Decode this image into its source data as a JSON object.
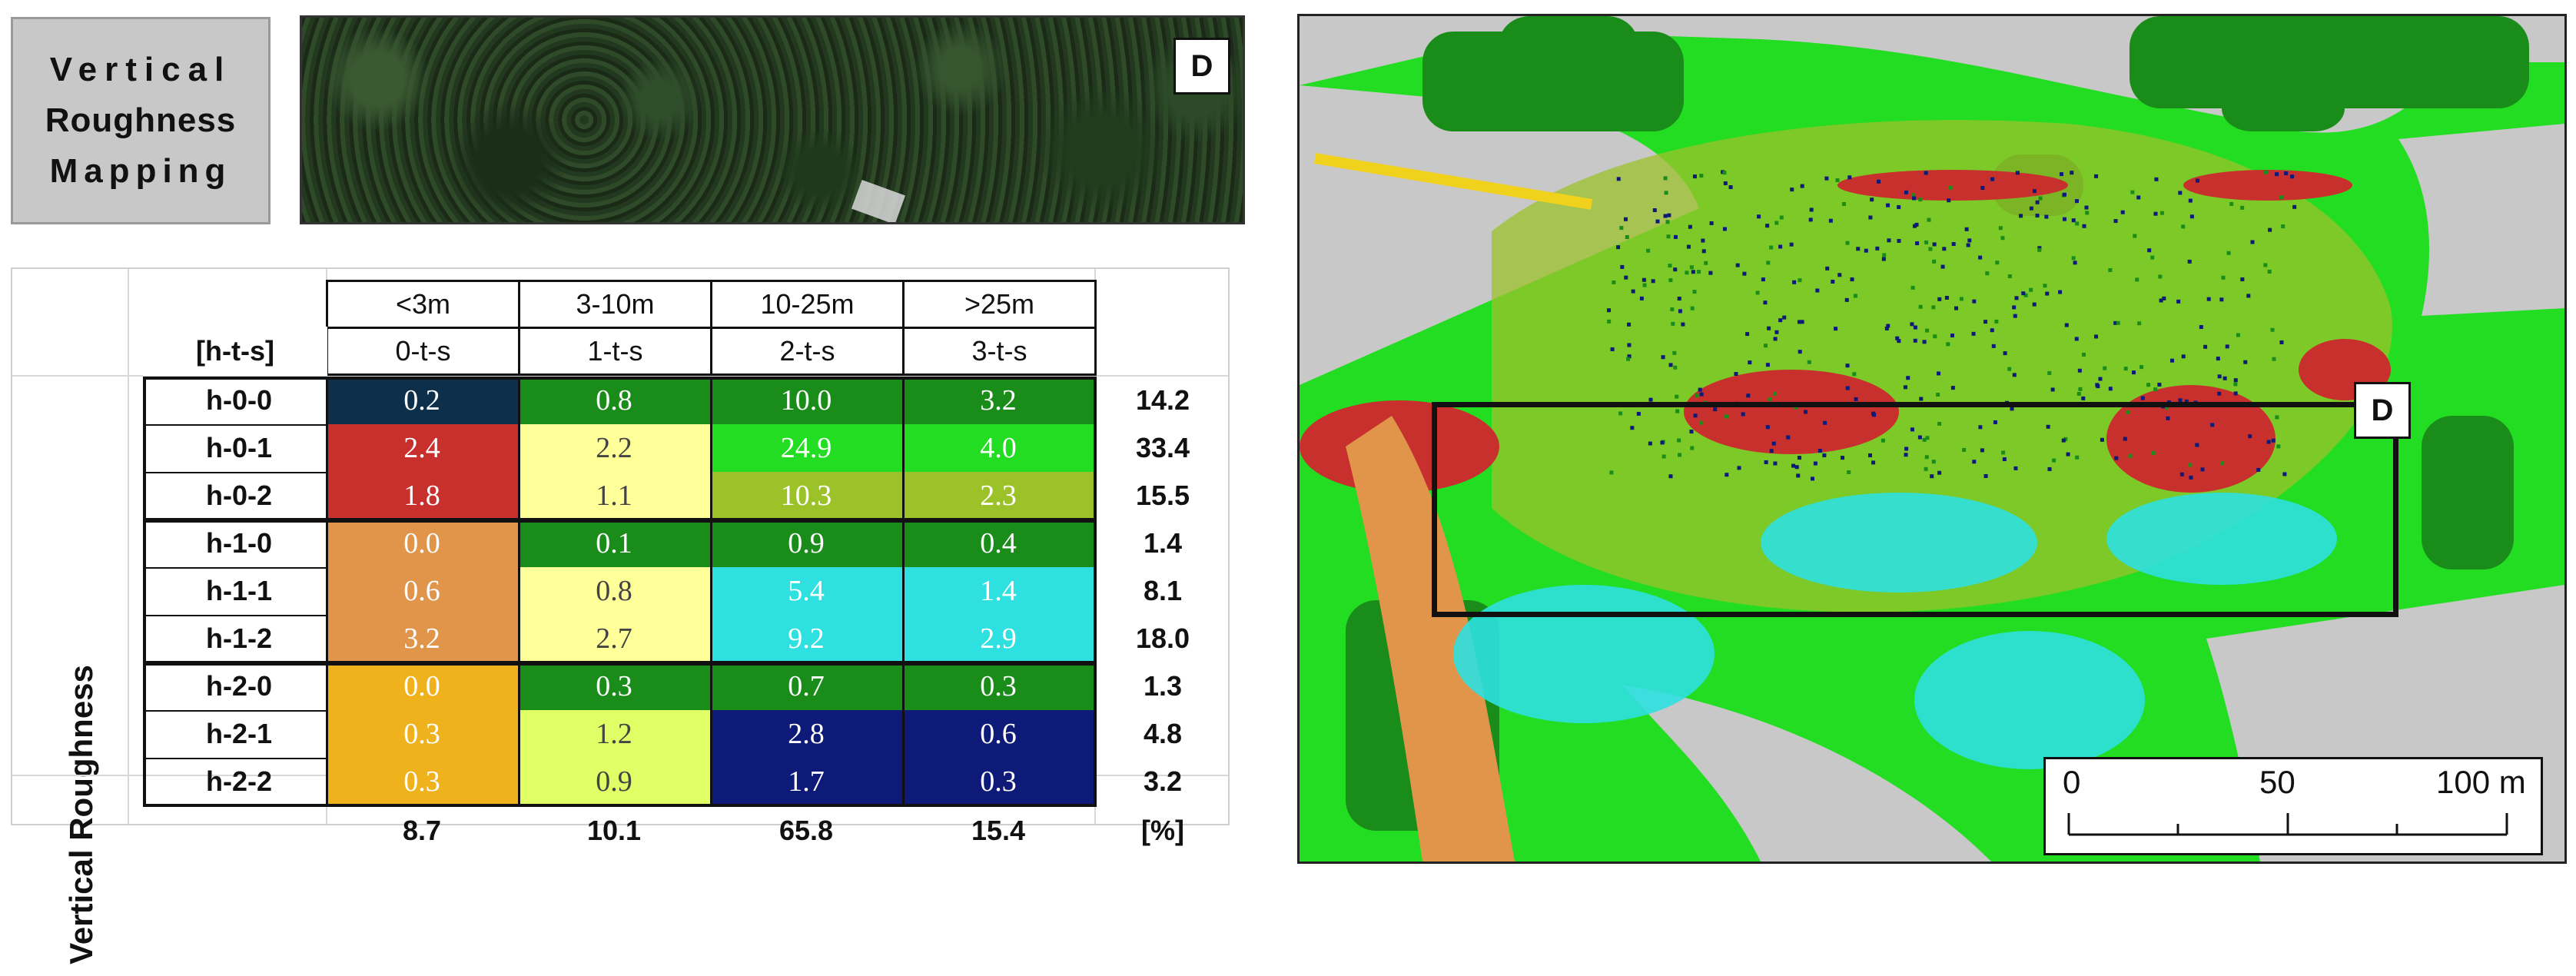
{
  "title_lines": [
    "Vertical",
    "Roughness",
    "Mapping"
  ],
  "aerial_label": "D",
  "table": {
    "height_classes": [
      "<3m",
      "3-10m",
      "10-25m",
      ">25m"
    ],
    "code_header": "[h-t-s]",
    "tree_classes": [
      "0-t-s",
      "1-t-s",
      "2-t-s",
      "3-t-s"
    ],
    "axis_label": "Vertical Roughness",
    "rows": [
      {
        "label": "h-0-0",
        "values": [
          "0.2",
          "0.8",
          "10.0",
          "3.2"
        ],
        "total": "14.2"
      },
      {
        "label": "h-0-1",
        "values": [
          "2.4",
          "2.2",
          "24.9",
          "4.0"
        ],
        "total": "33.4"
      },
      {
        "label": "h-0-2",
        "values": [
          "1.8",
          "1.1",
          "10.3",
          "2.3"
        ],
        "total": "15.5"
      },
      {
        "label": "h-1-0",
        "values": [
          "0.0",
          "0.1",
          "0.9",
          "0.4"
        ],
        "total": "1.4"
      },
      {
        "label": "h-1-1",
        "values": [
          "0.6",
          "0.8",
          "5.4",
          "1.4"
        ],
        "total": "8.1"
      },
      {
        "label": "h-1-2",
        "values": [
          "3.2",
          "2.7",
          "9.2",
          "2.9"
        ],
        "total": "18.0"
      },
      {
        "label": "h-2-0",
        "values": [
          "0.0",
          "0.3",
          "0.7",
          "0.3"
        ],
        "total": "1.3"
      },
      {
        "label": "h-2-1",
        "values": [
          "0.3",
          "1.2",
          "2.8",
          "0.6"
        ],
        "total": "4.8"
      },
      {
        "label": "h-2-2",
        "values": [
          "0.3",
          "0.9",
          "1.7",
          "0.3"
        ],
        "total": "3.2"
      }
    ],
    "column_totals": [
      "8.7",
      "10.1",
      "65.8",
      "15.4"
    ],
    "unit": "[%]",
    "cell_colors": [
      [
        "#0d2f4a",
        "#1a8c1a",
        "#1a8c1a",
        "#1a8c1a"
      ],
      [
        "#c8302e",
        "#ffff99",
        "#22dd22",
        "#22dd22"
      ],
      [
        "#c8302e",
        "#ffff99",
        "#9cc22a",
        "#9cc22a"
      ],
      [
        "#e0954b",
        "#1a8c1a",
        "#1a8c1a",
        "#1a8c1a"
      ],
      [
        "#e0954b",
        "#ffff99",
        "#2ee0e0",
        "#2ee0e0"
      ],
      [
        "#e0954b",
        "#ffff99",
        "#2ee0e0",
        "#2ee0e0"
      ],
      [
        "#f0b21c",
        "#1a8c1a",
        "#1a8c1a",
        "#1a8c1a"
      ],
      [
        "#f0b21c",
        "#e0ff66",
        "#0d1a78",
        "#0d1a78"
      ],
      [
        "#f0b21c",
        "#e0ff66",
        "#0d1a78",
        "#0d1a78"
      ]
    ]
  },
  "map": {
    "label": "D",
    "scale_labels": [
      "0",
      "50",
      "100 m"
    ],
    "colors": {
      "road": "#c8c8c8",
      "green_dark": "#1a8c1a",
      "green_bright": "#22dd22",
      "yellow_green": "#9cc22a",
      "red": "#c8302e",
      "orange": "#e0954b",
      "cyan": "#2ee0e0",
      "navy": "#0d1a78",
      "yellow": "#f0d21c"
    }
  }
}
